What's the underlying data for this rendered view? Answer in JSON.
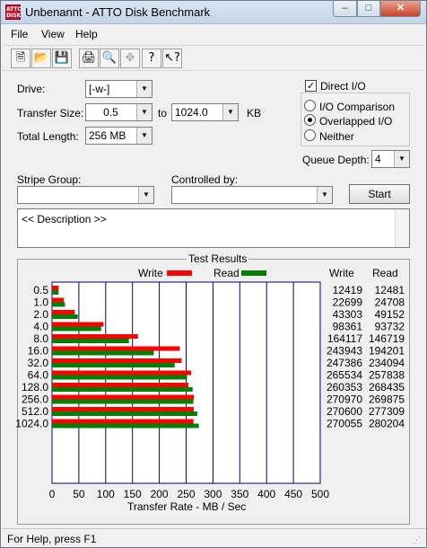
{
  "window": {
    "title": "Unbenannt - ATTO Disk Benchmark",
    "icon_text": "ATTO",
    "icon_subtext": "DISK"
  },
  "menu": [
    "File",
    "View",
    "Help"
  ],
  "toolbar": [
    "new-icon",
    "open-icon",
    "save-icon",
    "print-icon",
    "print-preview-icon",
    "move-icon",
    "help-icon",
    "context-help-icon"
  ],
  "settings": {
    "drive_label": "Drive:",
    "drive_value": "[-w-]",
    "transfer_size_label": "Transfer Size:",
    "transfer_from": "0.5",
    "to_label": "to",
    "transfer_to": "1024.0",
    "kb_label": "KB",
    "total_length_label": "Total Length:",
    "total_length_value": "256 MB",
    "direct_io_label": "Direct I/O",
    "io_comparison_label": "I/O Comparison",
    "overlapped_io_label": "Overlapped I/O",
    "neither_label": "Neither",
    "queue_depth_label": "Queue Depth:",
    "queue_depth_value": "4",
    "stripe_group_label": "Stripe Group:",
    "controlled_by_label": "Controlled by:",
    "start_label": "Start",
    "description": "<< Description >>"
  },
  "results": {
    "title": "Test Results",
    "write_legend": "Write",
    "read_legend": "Read",
    "write_col": "Write",
    "read_col": "Read",
    "xlabel": "Transfer Rate - MB / Sec",
    "xticks": [
      "0",
      "50",
      "100",
      "150",
      "200",
      "250",
      "300",
      "350",
      "400",
      "450",
      "500"
    ]
  },
  "colors": {
    "write": "#ff0000",
    "read": "#008000",
    "grid": "#000080"
  },
  "chart_data": {
    "type": "bar",
    "orientation": "horizontal",
    "title": "Test Results",
    "xlabel": "Transfer Rate - MB / Sec",
    "xlim": [
      0,
      500
    ],
    "categories": [
      "0.5",
      "1.0",
      "2.0",
      "4.0",
      "8.0",
      "16.0",
      "32.0",
      "64.0",
      "128.0",
      "256.0",
      "512.0",
      "1024.0"
    ],
    "series": [
      {
        "name": "Write",
        "values": [
          "12419",
          "22699",
          "43303",
          "98361",
          "164117",
          "243943",
          "247386",
          "265534",
          "260353",
          "270970",
          "270600",
          "270055"
        ]
      },
      {
        "name": "Read",
        "values": [
          "12481",
          "24708",
          "49152",
          "93732",
          "146719",
          "194201",
          "234094",
          "257838",
          "268435",
          "269875",
          "277309",
          "280204"
        ]
      }
    ],
    "value_unit_divisor": 1024
  },
  "status": {
    "text": "For Help, press F1"
  }
}
